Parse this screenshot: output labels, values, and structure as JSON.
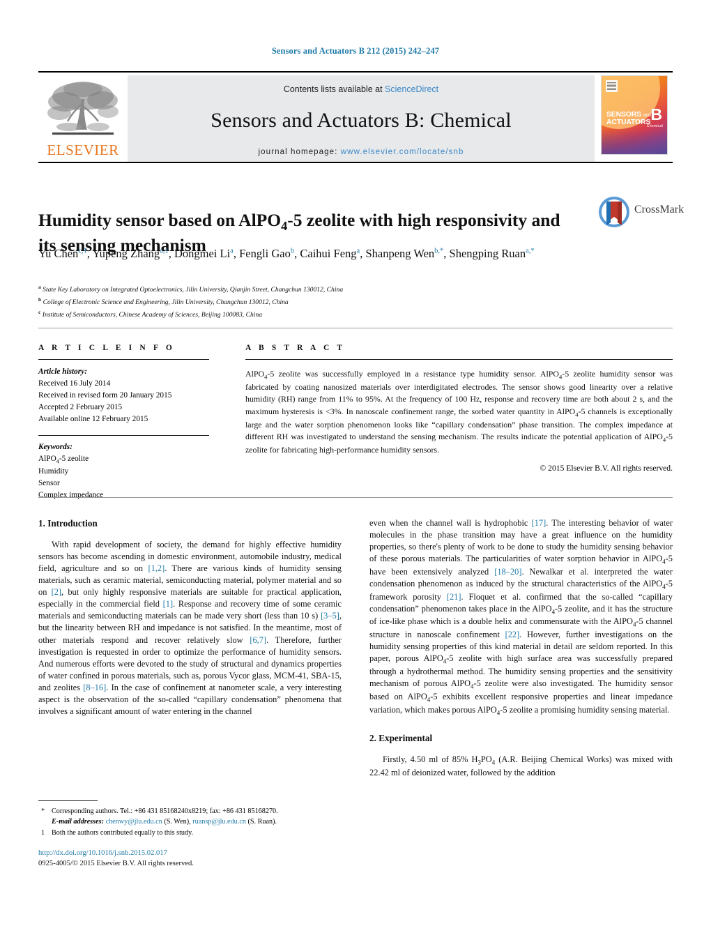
{
  "running_head": "Sensors and Actuators B 212 (2015) 242–247",
  "masthead": {
    "contents_prefix": "Contents lists available at ",
    "sciencedirect": "ScienceDirect",
    "journal_title": "Sensors and Actuators B: Chemical",
    "homepage_label": "journal homepage:",
    "homepage_url": "www.elsevier.com/locate/snb",
    "publisher_logo_text": "ELSEVIER",
    "cover": {
      "line1": "SENSORS",
      "line1_and": "and",
      "line2": "ACTUATORS",
      "letter": "B",
      "sub": "Chemical"
    },
    "accent_orange": "#E87722",
    "accent_blue": "#3a87c8",
    "panel_gray": "#e8e9eb"
  },
  "article": {
    "title": "Humidity sensor based on AlPO4-5 zeolite with high responsivity and its sensing mechanism",
    "crossmark_label": "CrossMark",
    "authors_html": "Yu Chen<sup>c,1</sup>, Yupeng Zhang<sup>a,1</sup>, Dongmei Li<sup>a</sup>, Fengli Gao<sup>b</sup>, Caihui Feng<sup>a</sup>, Shanpeng Wen<sup>b,</sup><sup>*</sup>, Shengping Ruan<sup>a,</sup><sup>*</sup>",
    "affiliations": [
      {
        "mark": "a",
        "text": "State Key Laboratory on Integrated Optoelectronics, Jilin University, Qianjin Street, Changchun 130012, China"
      },
      {
        "mark": "b",
        "text": "College of Electronic Science and Engineering, Jilin University, Changchun 130012, China"
      },
      {
        "mark": "c",
        "text": "Institute of Semiconductors, Chinese Academy of Sciences, Beijing 100083, China"
      }
    ]
  },
  "article_info": {
    "heading": "A R T I C L E   I N F O",
    "history_label": "Article history:",
    "history": [
      "Received 16 July 2014",
      "Received in revised form 20 January 2015",
      "Accepted 2 February 2015",
      "Available online 12 February 2015"
    ],
    "keywords_label": "Keywords:",
    "keywords_html": [
      "AlPO<sub>4</sub>-5 zeolite",
      "Humidity",
      "Sensor",
      "Complex impedance"
    ]
  },
  "abstract": {
    "heading": "A B S T R A C T",
    "text_html": "AlPO<sub>4</sub>-5 zeolite was successfully employed in a resistance type humidity sensor. AlPO<sub>4</sub>-5 zeolite humidity sensor was fabricated by coating nanosized materials over interdigitated electrodes. The sensor shows good linearity over a relative humidity (RH) range from 11% to 95%. At the frequency of 100 Hz, response and recovery time are both about 2 s, and the maximum hysteresis is &lt;3%. In nanoscale confinement range, the sorbed water quantity in AlPO<sub>4</sub>-5 channels is exceptionally large and the water sorption phenomenon looks like “capillary condensation” phase transition. The complex impedance at different RH was investigated to understand the sensing mechanism. The results indicate the potential application of AlPO<sub>4</sub>-5 zeolite for fabricating high-performance humidity sensors.",
    "copyright": "© 2015 Elsevier B.V. All rights reserved."
  },
  "body": {
    "section1_heading": "1.  Introduction",
    "section1_para_html": "With rapid development of society, the demand for highly effective humidity sensors has become ascending in domestic environment, automobile industry, medical field, agriculture and so on <span class=\"ref\">[1,2]</span>. There are various kinds of humidity sensing materials, such as ceramic material, semiconducting material, polymer material and so on <span class=\"ref\">[2]</span>, but only highly responsive materials are suitable for practical application, especially in the commercial field <span class=\"ref\">[1]</span>. Response and recovery time of some ceramic materials and semiconducting materials can be made very short (less than 10 s) <span class=\"ref\">[3–5]</span>, but the linearity between RH and impedance is not satisfied. In the meantime, most of other materials respond and recover relatively slow <span class=\"ref\">[6,7]</span>. Therefore, further investigation is requested in order to optimize the performance of humidity sensors. And numerous efforts were devoted to the study of structural and dynamics properties of water confined in porous materials, such as, porous Vycor glass, MCM-41, SBA-15, and zeolites <span class=\"ref\">[8–16]</span>. In the case of confinement at nanometer scale, a very interesting aspect is the observation of the so-called “capillary condensation” phenomena that involves a significant amount of water entering in the channel",
    "section1_cont_html": "even when the channel wall is hydrophobic <span class=\"ref\">[17]</span>. The interesting behavior of water molecules in the phase transition may have a great influence on the humidity properties, so there's plenty of work to be done to study the humidity sensing behavior of these porous materials. The particularities of water sorption behavior in AlPO<sub>4</sub>-5 have been extensively analyzed <span class=\"ref\">[18–20]</span>. Newalkar et al. interpreted the water condensation phenomenon as induced by the structural characteristics of the AlPO<sub>4</sub>-5 framework porosity <span class=\"ref\">[21]</span>. Floquet et al. confirmed that the so-called “capillary condensation” phenomenon takes place in the AlPO<sub>4</sub>-5 zeolite, and it has the structure of ice-like phase which is a double helix and commensurate with the AlPO<sub>4</sub>-5 channel structure in nanoscale confinement <span class=\"ref\">[22]</span>. However, further investigations on the humidity sensing properties of this kind material in detail are seldom reported. In this paper, porous AlPO<sub>4</sub>-5 zeolite with high surface area was successfully prepared through a hydrothermal method. The humidity sensing properties and the sensitivity mechanism of porous AlPO<sub>4</sub>-5 zeolite were also investigated. The humidity sensor based on AlPO<sub>4</sub>-5 exhibits excellent responsive properties and linear impedance variation, which makes porous AlPO<sub>4</sub>-5 zeolite a promising humidity sensing material.",
    "section2_heading": "2.  Experimental",
    "section2_para_html": "Firstly, 4.50 ml of 85% H<sub>3</sub>PO<sub>4</sub> (A.R. Beijing Chemical Works) was mixed with 22.42 ml of deionized water, followed by the addition"
  },
  "footnotes": {
    "corresponding_html": "Corresponding authors. Tel.: +86 431 85168240x8219; fax: +86 431 85168270.",
    "email_label": "E-mail addresses:",
    "email1": "chenwy@jlu.edu.cn",
    "email1_who": "(S. Wen),",
    "email2": "ruansp@jlu.edu.cn",
    "email2_who": "(S. Ruan).",
    "equal_contrib": "Both the authors contributed equally to this study.",
    "star_mark": "*",
    "one_mark": "1"
  },
  "identifiers": {
    "doi": "http://dx.doi.org/10.1016/j.snb.2015.02.017",
    "issn_line": "0925-4005/© 2015 Elsevier B.V. All rights reserved."
  }
}
